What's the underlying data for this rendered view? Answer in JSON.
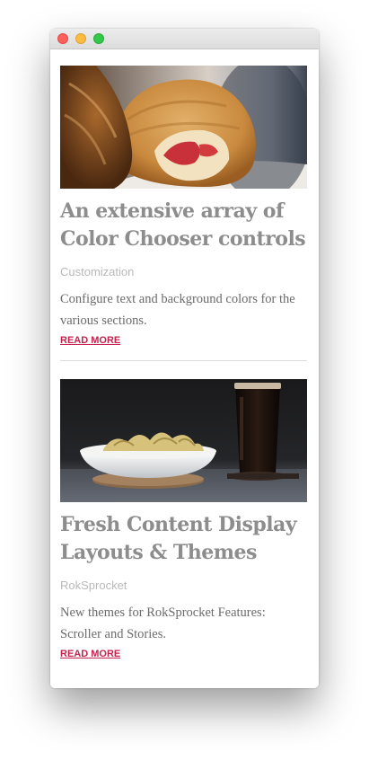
{
  "window": {
    "controls": [
      "close",
      "minimize",
      "maximize"
    ]
  },
  "articles": [
    {
      "image": "croissant-photo",
      "title": "An extensive array of Color Chooser controls",
      "category": "Customization",
      "description": "Configure text and background colors for the various sections.",
      "read_more": "READ MORE"
    },
    {
      "image": "snack-and-beer-photo",
      "title": "Fresh Content Display Layouts & Themes",
      "category": "RokSprocket",
      "description": "New themes for RokSprocket Features: Scroller and Stories.",
      "read_more": "READ MORE"
    }
  ],
  "colors": {
    "title": "#8d8d8d",
    "category": "#b9b9b9",
    "description": "#6b6b6b",
    "link": "#c5224d"
  }
}
